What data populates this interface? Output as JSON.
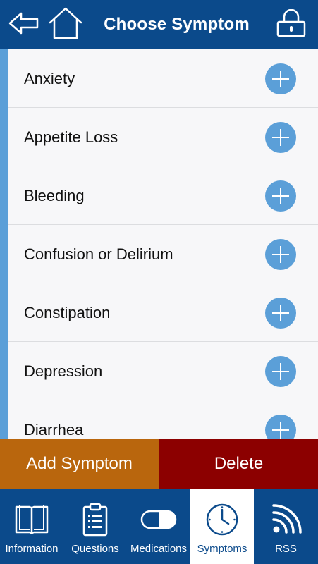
{
  "header": {
    "title": "Choose Symptom",
    "back_icon": "back-arrow-icon",
    "home_icon": "home-icon",
    "lock_icon": "lock-icon"
  },
  "symptoms": [
    {
      "label": "Anxiety"
    },
    {
      "label": "Appetite Loss"
    },
    {
      "label": "Bleeding"
    },
    {
      "label": "Confusion or Delirium"
    },
    {
      "label": "Constipation"
    },
    {
      "label": "Depression"
    },
    {
      "label": "Diarrhea"
    }
  ],
  "actions": {
    "add_label": "Add Symptom",
    "delete_label": "Delete"
  },
  "tabs": [
    {
      "label": "Information",
      "icon": "book-icon",
      "active": false
    },
    {
      "label": "Questions",
      "icon": "clipboard-icon",
      "active": false
    },
    {
      "label": "Medications",
      "icon": "pill-icon",
      "active": false
    },
    {
      "label": "Symptoms",
      "icon": "clock-icon",
      "active": true
    },
    {
      "label": "RSS",
      "icon": "rss-icon",
      "active": false
    }
  ],
  "colors": {
    "header_bg": "#0b4a8b",
    "accent_blue": "#5b9fd8",
    "add_button": "#b9660d",
    "delete_button": "#8c0000",
    "list_bg": "#f7f7f9"
  }
}
